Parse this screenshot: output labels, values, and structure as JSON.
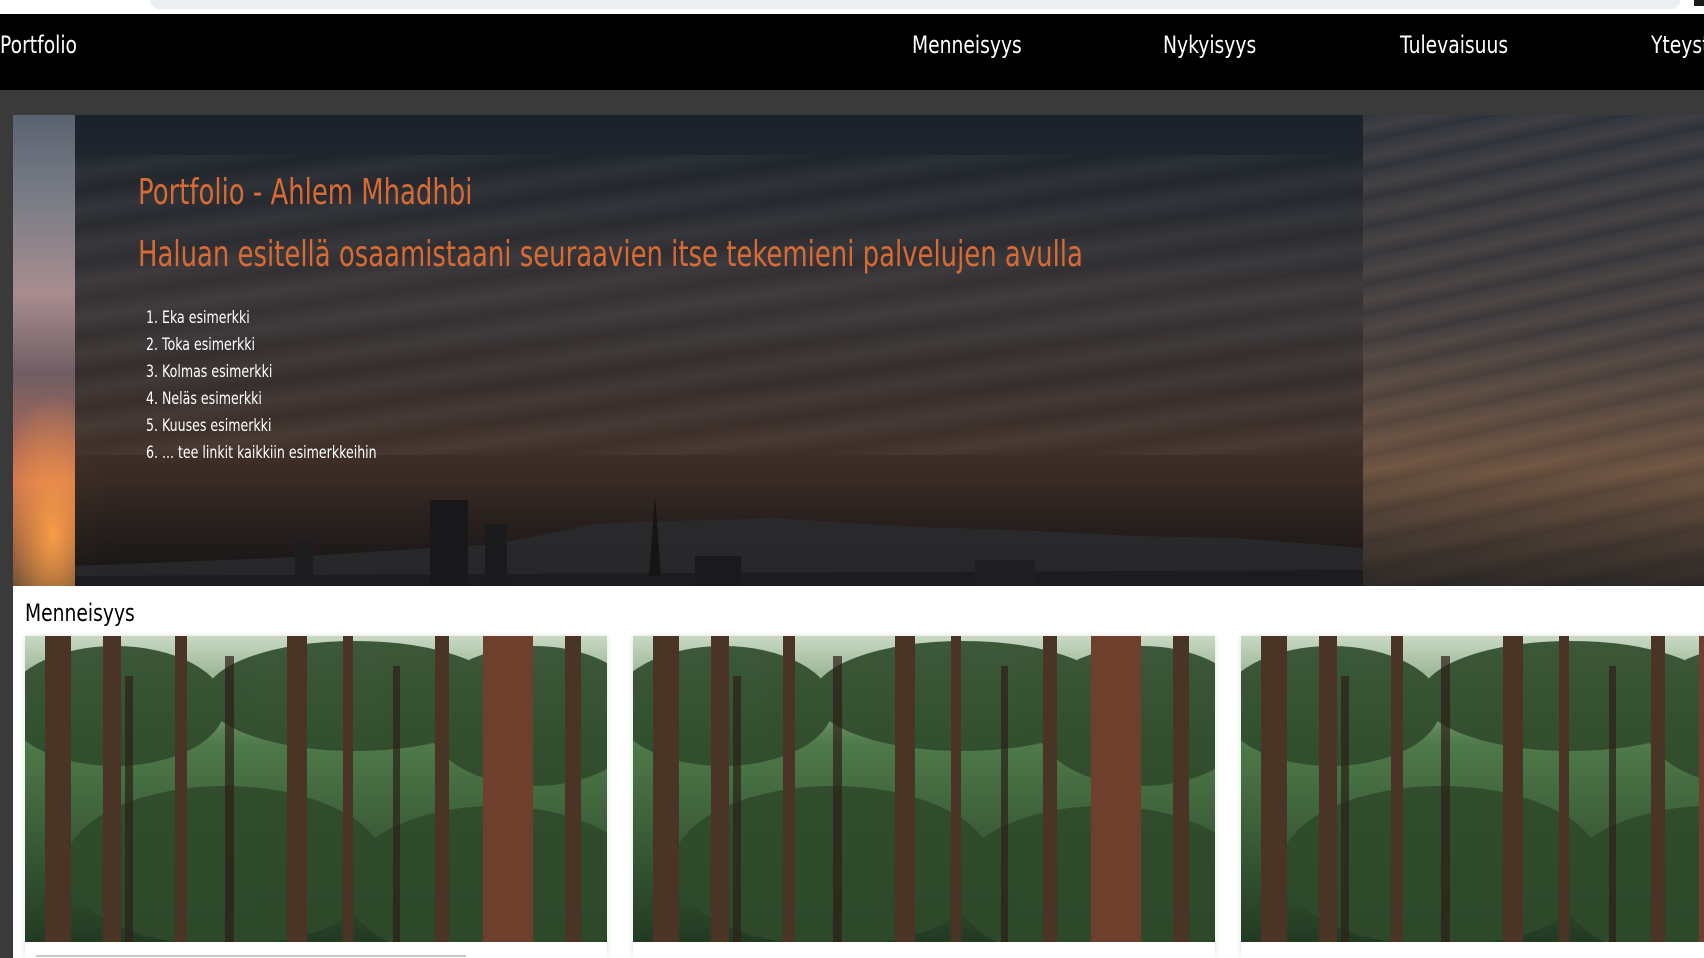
{
  "navbar": {
    "brand": "Portfolio",
    "links": [
      "Menneisyys",
      "Nykyisyys",
      "Tulevaisuus",
      "Yteystiedot"
    ]
  },
  "hero": {
    "title": "Portfolio - Ahlem Mhadhbi",
    "subtitle": "Haluan esitellä osaamistaani seuraavien itse tekemieni palvelujen avulla",
    "examples": [
      "1. Eka esimerkki",
      "2. Toka esimerkki",
      "3. Kolmas esimerkki",
      "4. Neläs esimerkki",
      "5. Kuuses esimerkki",
      "6. ... tee linkit kaikkiin esimerkkeihin"
    ]
  },
  "section": {
    "title": "Menneisyys",
    "cards": [
      {
        "image": "forest-image"
      },
      {
        "image": "forest-image"
      },
      {
        "image": "forest-image"
      }
    ]
  },
  "colors": {
    "accent": "#d86b34",
    "navbar_bg": "#000000",
    "page_bg": "#3a3a3a"
  }
}
